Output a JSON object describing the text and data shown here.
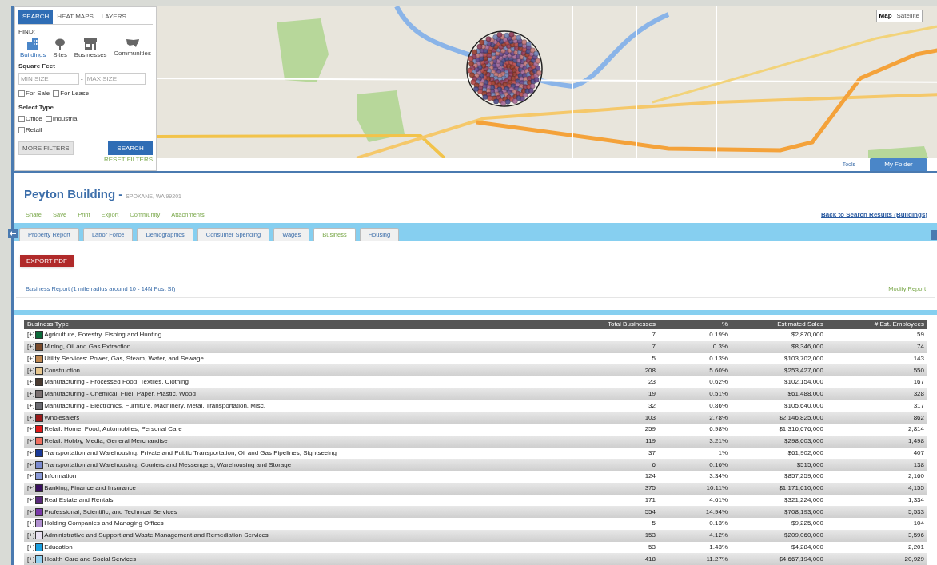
{
  "search_panel": {
    "tabs": [
      {
        "label": "SEARCH",
        "selected": true
      },
      {
        "label": "HEAT MAPS",
        "selected": false
      },
      {
        "label": "LAYERS",
        "selected": false
      }
    ],
    "find_label": "FIND:",
    "categories": [
      {
        "label": "Buildings",
        "selected": true
      },
      {
        "label": "Sites",
        "selected": false
      },
      {
        "label": "Businesses",
        "selected": false
      },
      {
        "label": "Communities",
        "selected": false
      }
    ],
    "square_feet_label": "Square Feet",
    "min_size": {
      "placeholder": "MIN SIZE"
    },
    "separator": "-",
    "max_size": {
      "placeholder": "MAX SIZE"
    },
    "listing_options": [
      {
        "label": "For Sale",
        "checked": false
      },
      {
        "label": "For Lease",
        "checked": false
      }
    ],
    "select_type_label": "Select Type",
    "types": [
      {
        "label": "Office",
        "checked": false
      },
      {
        "label": "Industrial",
        "checked": false
      },
      {
        "label": "Retail",
        "checked": false
      }
    ],
    "more_filters_button": "MORE FILTERS",
    "search_button": "SEARCH",
    "reset_link": "RESET FILTERS"
  },
  "map": {
    "type_buttons": [
      {
        "label": "Map",
        "selected": true
      },
      {
        "label": "Satellite",
        "selected": false
      }
    ]
  },
  "top_nav": [
    {
      "label": "Tools",
      "selected": false
    },
    {
      "label": "My Folder",
      "selected": true
    }
  ],
  "property": {
    "name": "Peyton Building",
    "dash": "-",
    "address": "SPOKANE, WA 99201"
  },
  "actions": [
    "Share",
    "Save",
    "Print",
    "Export",
    "Community",
    "Attachments"
  ],
  "back_link": "Back to Search Results (Buildings)",
  "report_tabs": [
    {
      "label": "Property Report",
      "selected": false
    },
    {
      "label": "Labor Force",
      "selected": false
    },
    {
      "label": "Demographics",
      "selected": false
    },
    {
      "label": "Consumer Spending",
      "selected": false
    },
    {
      "label": "Wages",
      "selected": false
    },
    {
      "label": "Business",
      "selected": true
    },
    {
      "label": "Housing",
      "selected": false
    }
  ],
  "export_button": "EXPORT PDF",
  "report_title": "Business Report (1 mile radius around 10 - 14N Post St)",
  "modify_link": "Modify Report",
  "table": {
    "columns": [
      "Business Type",
      "Total Businesses",
      "%",
      "Estimated Sales",
      "# Est. Employees"
    ],
    "rows": [
      {
        "toggle": "[+]",
        "color": "#0b6b3a",
        "type": "Agriculture, Forestry, Fishing and Hunting",
        "total": "7",
        "percent": "0.19%",
        "sales": "$2,870,000",
        "employees": "59"
      },
      {
        "toggle": "[+]",
        "color": "#7a4a2a",
        "type": "Mining, Oil and Gas Extraction",
        "total": "7",
        "percent": "0.3%",
        "sales": "$8,346,000",
        "employees": "74"
      },
      {
        "toggle": "[+]",
        "color": "#c08850",
        "type": "Utility Services: Power, Gas, Steam, Water, and Sewage",
        "total": "5",
        "percent": "0.13%",
        "sales": "$103,702,000",
        "employees": "143"
      },
      {
        "toggle": "[+]",
        "color": "#e8c890",
        "type": "Construction",
        "total": "208",
        "percent": "5.60%",
        "sales": "$253,427,000",
        "employees": "550"
      },
      {
        "toggle": "[+]",
        "color": "#4a3a30",
        "type": "Manufacturing - Processed Food, Textiles, Clothing",
        "total": "23",
        "percent": "0.62%",
        "sales": "$102,154,000",
        "employees": "167"
      },
      {
        "toggle": "[+]",
        "color": "#7a7070",
        "type": "Manufacturing - Chemical, Fuel, Paper, Plastic, Wood",
        "total": "19",
        "percent": "0.51%",
        "sales": "$61,488,000",
        "employees": "328"
      },
      {
        "toggle": "[+]",
        "color": "#6a6a70",
        "type": "Manufacturing - Electronics, Furniture, Machinery, Metal, Transportation, Misc.",
        "total": "32",
        "percent": "0.86%",
        "sales": "$105,640,000",
        "employees": "317"
      },
      {
        "toggle": "[+]",
        "color": "#9a1a1a",
        "type": "Wholesalers",
        "total": "103",
        "percent": "2.78%",
        "sales": "$2,146,825,000",
        "employees": "862"
      },
      {
        "toggle": "[+]",
        "color": "#e01818",
        "type": "Retail: Home, Food, Automobiles, Personal Care",
        "total": "259",
        "percent": "6.98%",
        "sales": "$1,316,676,000",
        "employees": "2,814"
      },
      {
        "toggle": "[+]",
        "color": "#f07060",
        "type": "Retail: Hobby, Media, General Merchandise",
        "total": "119",
        "percent": "3.21%",
        "sales": "$298,603,000",
        "employees": "1,498"
      },
      {
        "toggle": "[+]",
        "color": "#1a3a9a",
        "type": "Transportation and Warehousing: Private and Public Transportation, Oil and Gas Pipelines, Sightseeing",
        "total": "37",
        "percent": "1%",
        "sales": "$61,902,000",
        "employees": "407"
      },
      {
        "toggle": "[+]",
        "color": "#7a8ad0",
        "type": "Transportation and Warehousing: Couriers and Messengers, Warehousing and Storage",
        "total": "6",
        "percent": "0.16%",
        "sales": "$515,000",
        "employees": "138"
      },
      {
        "toggle": "[+]",
        "color": "#8a9ad8",
        "type": "Information",
        "total": "124",
        "percent": "3.34%",
        "sales": "$857,259,000",
        "employees": "2,160"
      },
      {
        "toggle": "[+]",
        "color": "#3a1060",
        "type": "Banking, Finance and Insurance",
        "total": "375",
        "percent": "10.11%",
        "sales": "$1,171,610,000",
        "employees": "4,155"
      },
      {
        "toggle": "[+]",
        "color": "#5a2a7a",
        "type": "Real Estate and Rentals",
        "total": "171",
        "percent": "4.61%",
        "sales": "$321,224,000",
        "employees": "1,334"
      },
      {
        "toggle": "[+]",
        "color": "#7a3aa8",
        "type": "Professional, Scientific, and Technical Services",
        "total": "554",
        "percent": "14.94%",
        "sales": "$708,193,000",
        "employees": "5,533"
      },
      {
        "toggle": "[+]",
        "color": "#b090d0",
        "type": "Holding Companies and Managing Offices",
        "total": "5",
        "percent": "0.13%",
        "sales": "$9,225,000",
        "employees": "104"
      },
      {
        "toggle": "[+]",
        "color": "#e8e0f0",
        "type": "Administrative and Support and Waste Management and Remediation Services",
        "total": "153",
        "percent": "4.12%",
        "sales": "$209,060,000",
        "employees": "3,596"
      },
      {
        "toggle": "[+]",
        "color": "#1aa0e0",
        "type": "Education",
        "total": "53",
        "percent": "1.43%",
        "sales": "$4,284,000",
        "employees": "2,201"
      },
      {
        "toggle": "[+]",
        "color": "#90d0f0",
        "type": "Health Care and Social Services",
        "total": "418",
        "percent": "11.27%",
        "sales": "$4,667,194,000",
        "employees": "20,929"
      }
    ]
  }
}
